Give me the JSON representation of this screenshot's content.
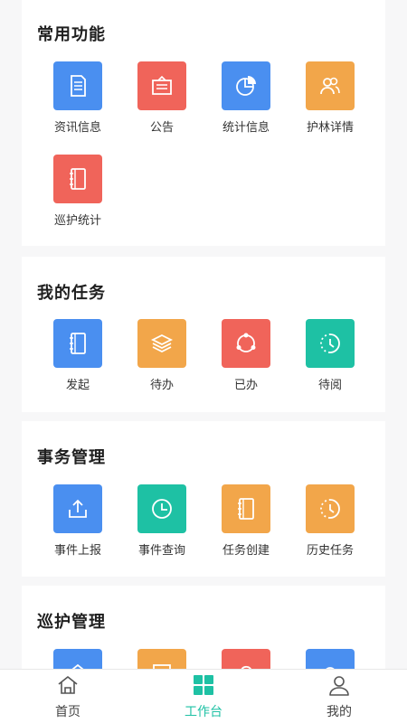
{
  "sections": [
    {
      "title": "常用功能",
      "items": [
        {
          "label": "资讯信息",
          "color": "#4a8ff0",
          "icon": "document-icon"
        },
        {
          "label": "公告",
          "color": "#f0645a",
          "icon": "bulletin-icon"
        },
        {
          "label": "统计信息",
          "color": "#4a8ff0",
          "icon": "pie-chart-icon"
        },
        {
          "label": "护林详情",
          "color": "#f2a64a",
          "icon": "users-icon"
        },
        {
          "label": "巡护统计",
          "color": "#f0645a",
          "icon": "notebook-icon"
        }
      ]
    },
    {
      "title": "我的任务",
      "items": [
        {
          "label": "发起",
          "color": "#4a8ff0",
          "icon": "notebook-icon"
        },
        {
          "label": "待办",
          "color": "#f2a64a",
          "icon": "layers-icon"
        },
        {
          "label": "已办",
          "color": "#f0645a",
          "icon": "share-circle-icon"
        },
        {
          "label": "待阅",
          "color": "#1ec1a4",
          "icon": "clock-dashed-icon"
        }
      ]
    },
    {
      "title": "事务管理",
      "items": [
        {
          "label": "事件上报",
          "color": "#4a8ff0",
          "icon": "upload-icon"
        },
        {
          "label": "事件查询",
          "color": "#1ec1a4",
          "icon": "clock-icon"
        },
        {
          "label": "任务创建",
          "color": "#f2a64a",
          "icon": "notebook-icon"
        },
        {
          "label": "历史任务",
          "color": "#f2a64a",
          "icon": "clock-dashed-icon"
        }
      ]
    },
    {
      "title": "巡护管理",
      "items": [
        {
          "color": "#4a8ff0",
          "icon": "home-icon"
        },
        {
          "color": "#f2a64a",
          "icon": "list-icon"
        },
        {
          "color": "#f0645a",
          "icon": "cloud-icon"
        },
        {
          "color": "#4a8ff0",
          "icon": "camera-icon"
        }
      ]
    }
  ],
  "nav": {
    "items": [
      {
        "label": "首页",
        "icon": "home-outline-icon"
      },
      {
        "label": "工作台",
        "icon": "grid-icon",
        "active": true
      },
      {
        "label": "我的",
        "icon": "person-icon"
      }
    ],
    "active_color": "#1ec1a4"
  }
}
